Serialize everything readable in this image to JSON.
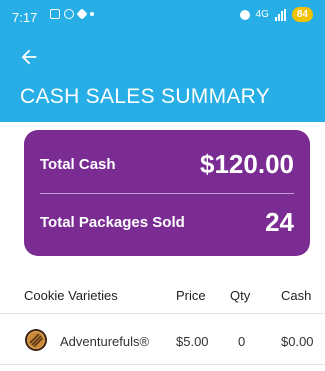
{
  "status_bar": {
    "time": "7:17",
    "network": "4G",
    "battery": "84"
  },
  "header": {
    "title": "CASH SALES SUMMARY"
  },
  "summary": {
    "total_cash_label": "Total Cash",
    "total_cash_value": "$120.00",
    "total_packages_label": "Total Packages Sold",
    "total_packages_value": "24"
  },
  "table": {
    "columns": [
      "Cookie Varieties",
      "Price",
      "Qty",
      "Cash"
    ],
    "rows": [
      {
        "variety": "Adventurefuls®",
        "price": "$5.00",
        "qty": "0",
        "cash": "$0.00"
      }
    ]
  },
  "colors": {
    "header_bg": "#27aee6",
    "card_bg": "#7a2c93",
    "battery_bg": "#f0c200"
  },
  "icons": [
    "back-arrow-icon",
    "adventurefuls-cookie-icon"
  ]
}
